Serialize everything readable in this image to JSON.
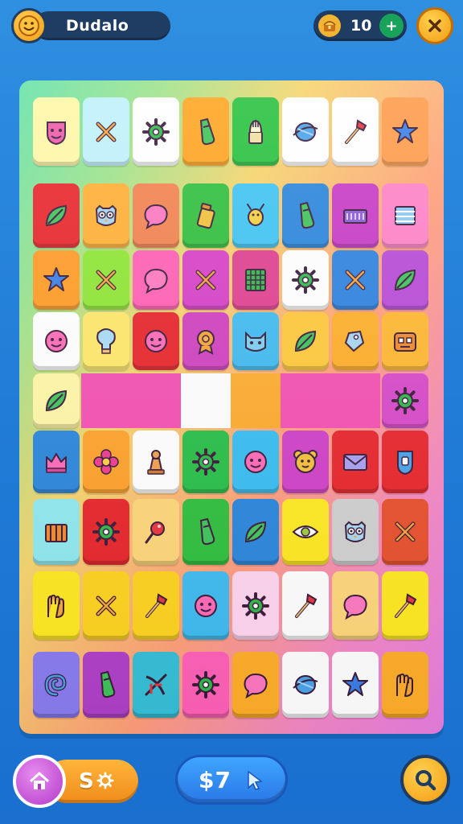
{
  "header": {
    "player_name": "Dudalo",
    "avatar_icon": "smiley-face-icon",
    "coins_value": "10",
    "coins_icon": "treasure-icon",
    "add_coins_icon": "plus-icon",
    "close_icon": "close-icon"
  },
  "footer": {
    "home_icon": "home-icon",
    "settings_value": "S",
    "settings_icon": "gear-icon",
    "center_value": "$7",
    "center_icon": "cursor-icon",
    "search_icon": "search-icon"
  },
  "board": {
    "rows": [
      [
        {
          "color": "#fff7a6",
          "icon": "face-shield-icon"
        },
        {
          "color": "#bff1fb",
          "icon": "cross-icon"
        },
        {
          "color": "#ffffff",
          "icon": "gear-icon"
        },
        {
          "color": "#ffa520",
          "icon": "bottle-icon"
        },
        {
          "color": "#28c13f",
          "icon": "cup-icon"
        },
        {
          "color": "#ffffff",
          "icon": "planet-icon"
        },
        {
          "color": "#ffffff",
          "icon": "wand-icon"
        },
        {
          "color": "#ff9b4a",
          "icon": "star-icon"
        }
      ],
      [
        {
          "color": "#e8252b",
          "icon": "leaf-icon"
        },
        {
          "color": "#ffb033",
          "icon": "owl-icon"
        },
        {
          "color": "#f2824f",
          "icon": "bubble-icon"
        },
        {
          "color": "#2fbf3d",
          "icon": "jar-icon"
        },
        {
          "color": "#3fc4f2",
          "icon": "bug-icon"
        },
        {
          "color": "#2a86dc",
          "icon": "bottle-icon"
        },
        {
          "color": "#c83ac6",
          "icon": "treasure-icon"
        },
        {
          "color": "#ff82c8",
          "icon": "box-icon"
        }
      ],
      [
        {
          "color": "#ff9b25",
          "icon": "star-icon"
        },
        {
          "color": "#8ee634",
          "icon": "cross-icon"
        },
        {
          "color": "#ff5fb3",
          "icon": "bubble-icon"
        },
        {
          "color": "#d840c8",
          "icon": "cross-icon"
        },
        {
          "color": "#e04090",
          "icon": "grid-icon"
        },
        {
          "color": "#ffffff",
          "icon": "gear-icon"
        },
        {
          "color": "#2d82e0",
          "icon": "cross-icon"
        },
        {
          "color": "#b84ad8",
          "icon": "leaf-icon"
        }
      ],
      [
        {
          "color": "#ffffff",
          "icon": "face-icon"
        },
        {
          "color": "#ffe86a",
          "icon": "bulb-icon"
        },
        {
          "color": "#e8252b",
          "icon": "face-icon"
        },
        {
          "color": "#d040c0",
          "icon": "badge-icon"
        },
        {
          "color": "#3fbbf0",
          "icon": "cat-icon"
        },
        {
          "color": "#ffc93a",
          "icon": "leaf-icon"
        },
        {
          "color": "#ffae28",
          "icon": "tag-icon"
        },
        {
          "color": "#ffb830",
          "icon": "robot-icon"
        }
      ],
      [
        {
          "color": "#fff7a6",
          "icon": "leaf-icon"
        },
        {
          "color": "#f44fb2",
          "icon": "none"
        },
        {
          "color": "#f44fb2",
          "icon": "none"
        },
        {
          "color": "#ffffff",
          "icon": "none"
        },
        {
          "color": "#ffab2e",
          "icon": "none"
        },
        {
          "color": "#f44fb2",
          "icon": "none"
        },
        {
          "color": "#f44fb2",
          "icon": "none"
        },
        {
          "color": "#d848c8",
          "icon": "gear-icon"
        }
      ],
      [
        {
          "color": "#2a86dc",
          "icon": "crown-icon"
        },
        {
          "color": "#ffa22a",
          "icon": "flower-icon"
        },
        {
          "color": "#ffffff",
          "icon": "pawn-icon"
        },
        {
          "color": "#27bf47",
          "icon": "gear-icon"
        },
        {
          "color": "#37bdf2",
          "icon": "face-icon"
        },
        {
          "color": "#d040c8",
          "icon": "bear-icon"
        },
        {
          "color": "#e8252b",
          "icon": "mail-icon"
        },
        {
          "color": "#e8252b",
          "icon": "shield-icon"
        }
      ],
      [
        {
          "color": "#8fe9ef",
          "icon": "chest-icon"
        },
        {
          "color": "#e8252b",
          "icon": "gear-icon"
        },
        {
          "color": "#ffd77a",
          "icon": "pin-icon"
        },
        {
          "color": "#2fbf3d",
          "icon": "bottle-icon"
        },
        {
          "color": "#2a86dc",
          "icon": "leaf-icon"
        },
        {
          "color": "#ffe920",
          "icon": "eye-icon"
        },
        {
          "color": "#d0d0d0",
          "icon": "owl-icon"
        },
        {
          "color": "#e8502b",
          "icon": "cross-icon"
        }
      ],
      [
        {
          "color": "#ffe920",
          "icon": "glove-icon"
        },
        {
          "color": "#ffd31f",
          "icon": "cross-icon"
        },
        {
          "color": "#ffd31f",
          "icon": "wand-icon"
        },
        {
          "color": "#3fbbf0",
          "icon": "face-icon"
        },
        {
          "color": "#ffd5f0",
          "icon": "gear-icon"
        },
        {
          "color": "#ffffff",
          "icon": "wand-icon"
        },
        {
          "color": "#ffd77a",
          "icon": "bubble-icon"
        },
        {
          "color": "#ffe920",
          "icon": "wand-icon"
        }
      ],
      [
        {
          "color": "#8a7cf0",
          "icon": "swirl-icon"
        },
        {
          "color": "#b040c8",
          "icon": "bottle-icon"
        },
        {
          "color": "#36c0d8",
          "icon": "crossbow-icon"
        },
        {
          "color": "#ff60b8",
          "icon": "gear-icon"
        },
        {
          "color": "#ffae28",
          "icon": "bubble-icon"
        },
        {
          "color": "#ffffff",
          "icon": "planet-icon"
        },
        {
          "color": "#ffffff",
          "icon": "star-icon"
        },
        {
          "color": "#ffae28",
          "icon": "glove-icon"
        }
      ]
    ]
  }
}
